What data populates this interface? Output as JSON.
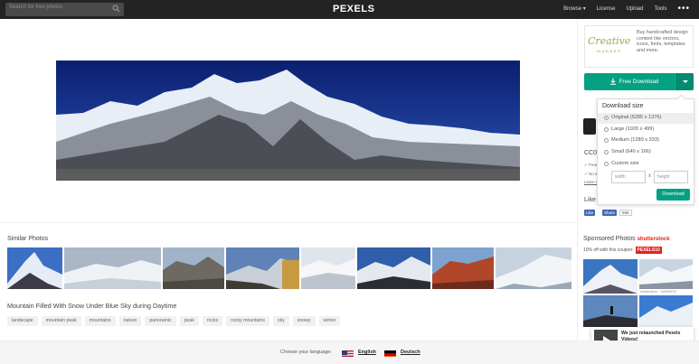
{
  "header": {
    "search_placeholder": "Search for free photos",
    "logo": "PEXELS",
    "nav": {
      "browse": "Browse",
      "license": "License",
      "upload": "Upload",
      "tools": "Tools",
      "more": "•••"
    }
  },
  "sidebar": {
    "ad": {
      "logo_top": "Creative",
      "logo_bottom": "MARKET",
      "text": "Buy handcrafted design content like vectors, icons, fonts, templates and more."
    },
    "download": {
      "label": "Free Download"
    },
    "dropdown": {
      "title": "Download size",
      "options": [
        {
          "label": "Original (5285 x 1376)",
          "selected": true
        },
        {
          "label": "Large (1920 x 499)",
          "selected": false
        },
        {
          "label": "Medium (1280 x 333)",
          "selected": false
        },
        {
          "label": "Small (640 x 166)",
          "selected": false
        },
        {
          "label": "Custom size",
          "selected": false
        }
      ],
      "width_placeholder": "width",
      "height_placeholder": "height",
      "x": "x",
      "button": "Download"
    },
    "license": {
      "title": "CC0",
      "line1": "✓ Free",
      "line2": "✓ No a",
      "learn": "Learn m"
    },
    "like": {
      "title": "Like",
      "fb_like": "Like",
      "fb_share": "Share",
      "count": "55K"
    }
  },
  "similar": {
    "title": "Similar Photos"
  },
  "photo": {
    "caption": "Mountain Filled With Snow Under Blue Sky during Daytime",
    "tags": [
      "landscape",
      "mountain peak",
      "mountains",
      "nature",
      "panoramic",
      "peak",
      "rocks",
      "rocky mountains",
      "sky",
      "snowy",
      "winter"
    ]
  },
  "sponsored": {
    "title": "Sponsored Photos",
    "brand": "shutterstock",
    "coupon_text": "10% off with this coupon:",
    "coupon_code": "PEXELS10",
    "image_caption": "shutterstock · 149598729"
  },
  "toast": {
    "title": "We just relaunched Pexels Videos!",
    "subtitle": "Find free high-quality videos →"
  },
  "footer": {
    "label": "Choose your language:",
    "english": "English",
    "deutsch": "Deutsch"
  }
}
